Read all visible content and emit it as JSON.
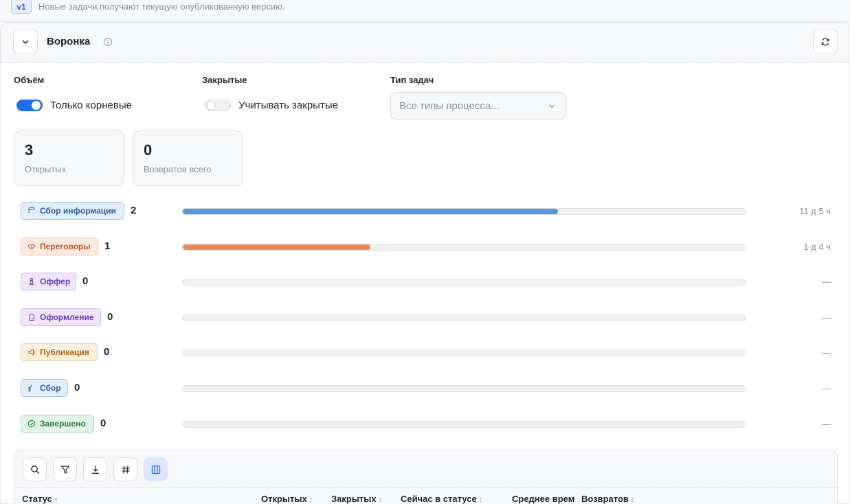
{
  "version_banner": {
    "badge": "v1",
    "text": "Новые задачи получают текущую опубликованную версию."
  },
  "panel": {
    "title": "Воронка",
    "icons": {
      "collapse": "chevron-down-icon",
      "info": "info-icon",
      "refresh": "refresh-icon"
    }
  },
  "filters": {
    "volume": {
      "label": "Объём",
      "toggle_label": "Только корневые",
      "on": true
    },
    "closed": {
      "label": "Закрытые",
      "toggle_label": "Учитывать закрытые",
      "on": false
    },
    "task_type": {
      "label": "Тип задач",
      "placeholder": "Все типы процесса..."
    }
  },
  "summary": [
    {
      "value": "3",
      "label": "Открытых"
    },
    {
      "value": "0",
      "label": "Возвратов всего"
    }
  ],
  "colors": {
    "accent": "#1f6fe8"
  },
  "funnel": [
    {
      "label": "Сбор информации",
      "count": "2",
      "share": 0.667,
      "duration": "11 д 5 ч",
      "icon": "database-icon",
      "bg": "#e3eefc",
      "border": "#a9c6ef",
      "color": "#2c5d9e",
      "bar": "#5b95dd"
    },
    {
      "label": "Переговоры",
      "count": "1",
      "share": 0.333,
      "duration": "1 д 4 ч",
      "icon": "handshake-icon",
      "bg": "#fdeadf",
      "border": "#f3bfa2",
      "color": "#b8552a",
      "bar": "#ee8756"
    },
    {
      "label": "Оффер",
      "count": "0",
      "share": 0,
      "duration": "—",
      "icon": "chess-piece-icon",
      "bg": "#efe6fb",
      "border": "#cdb5ef",
      "color": "#6b3bb0",
      "bar": "#9a6ee0"
    },
    {
      "label": "Оформление",
      "count": "0",
      "share": 0,
      "duration": "—",
      "icon": "document-icon",
      "bg": "#efe6fb",
      "border": "#cdb5ef",
      "color": "#6b3bb0",
      "bar": "#9a6ee0"
    },
    {
      "label": "Публикация",
      "count": "0",
      "share": 0,
      "duration": "—",
      "icon": "megaphone-icon",
      "bg": "#fdf0dc",
      "border": "#f0cf99",
      "color": "#a86510",
      "bar": "#e8a23c"
    },
    {
      "label": "Сбор",
      "count": "0",
      "share": 0,
      "duration": "—",
      "icon": "thumb-up-icon",
      "bg": "#e3eefc",
      "border": "#a9c6ef",
      "color": "#2c5d9e",
      "bar": "#5b95dd"
    },
    {
      "label": "Завершено",
      "count": "0",
      "share": 0,
      "duration": "—",
      "icon": "check-circle-icon",
      "bg": "#e2f5e6",
      "border": "#a6dbb1",
      "color": "#2c7a3e",
      "bar": "#4caf68"
    }
  ],
  "grid": {
    "toolbar_icons": [
      "search-icon",
      "filter-icon",
      "download-icon",
      "hash-icon",
      "columns-icon"
    ],
    "columns": [
      {
        "label": "Статус",
        "sort": "↑"
      },
      {
        "label": "Открытых",
        "sort": "↕"
      },
      {
        "label": "Закрытых",
        "sort": "↕"
      },
      {
        "label": "Сейчас в статусе",
        "sort": "↕"
      },
      {
        "label": "Среднее врем",
        "sort": ""
      },
      {
        "label": "Возвратов",
        "sort": "↕"
      }
    ]
  }
}
